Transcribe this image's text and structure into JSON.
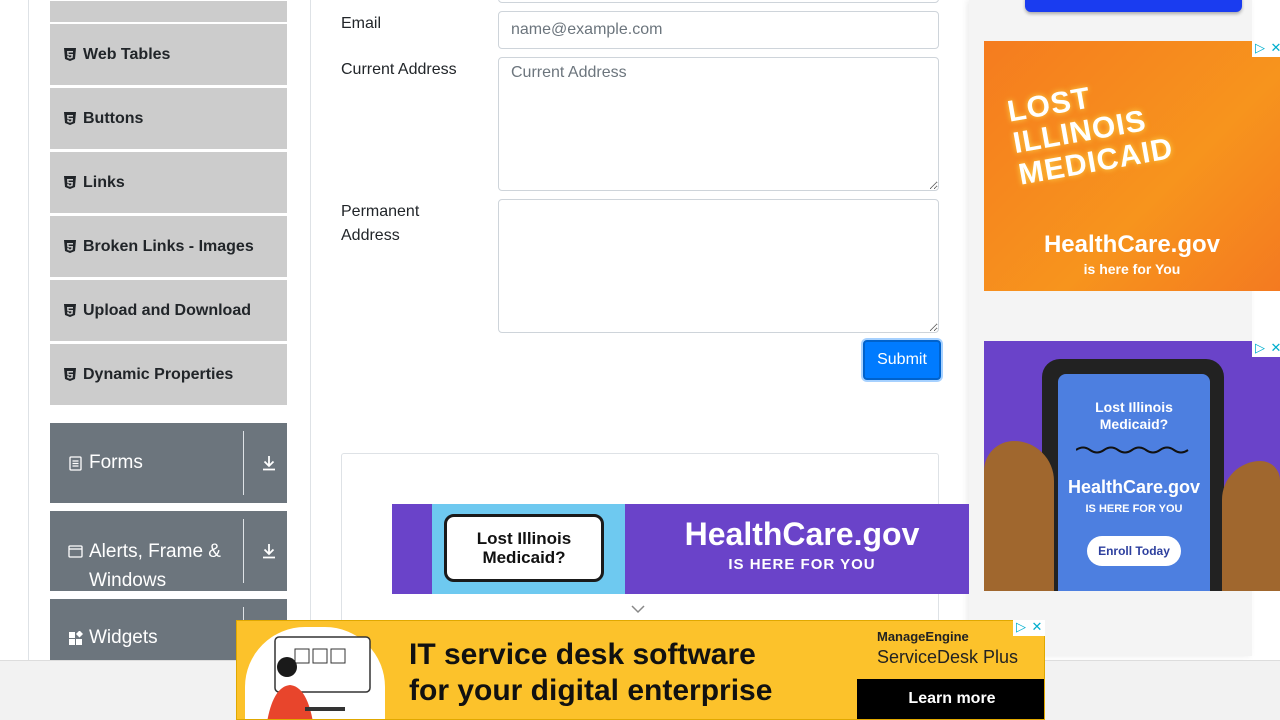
{
  "sidebar": {
    "elements_items": [
      {
        "label": "Web Tables"
      },
      {
        "label": "Buttons"
      },
      {
        "label": "Links"
      },
      {
        "label": "Broken Links - Images"
      },
      {
        "label": "Upload and Download"
      },
      {
        "label": "Dynamic Properties"
      }
    ],
    "groups": [
      {
        "label": "Forms"
      },
      {
        "label": "Alerts, Frame & Windows"
      },
      {
        "label": "Widgets"
      }
    ]
  },
  "form": {
    "email_label": "Email",
    "email_placeholder": "name@example.com",
    "current_address_label": "Current Address",
    "current_address_placeholder": "Current Address",
    "permanent_address_label": "Permanent Address",
    "submit_label": "Submit"
  },
  "ads": {
    "orange": {
      "headline": "LOST ILLINOIS MEDICAID",
      "brand": "HealthCare.gov",
      "tagline": "is here for You"
    },
    "blue": {
      "headline": "Lost Illinois Medicaid?",
      "brand": "HealthCare.gov",
      "tagline": "IS HERE FOR YOU",
      "cta": "Enroll Today"
    },
    "banner": {
      "card": "Lost Illinois Medicaid?",
      "brand": "HealthCare.gov",
      "tagline": "IS HERE FOR YOU"
    },
    "bottom": {
      "headline_1": "IT service desk software",
      "headline_2": "for your digital enterprise",
      "brand_1": "ManageEngine",
      "brand_2": "ServiceDesk Plus",
      "cta": "Learn more"
    }
  },
  "colors": {
    "primary": "#007bff",
    "menu_item_bg": "#cccccc",
    "group_bg": "#6c757d"
  }
}
